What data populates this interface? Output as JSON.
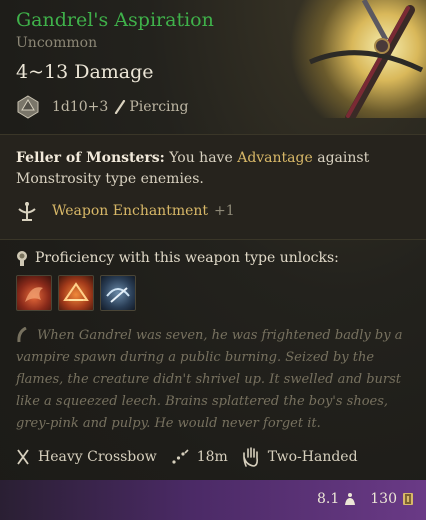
{
  "item": {
    "name": "Gandrel's Aspiration",
    "rarity": "Uncommon",
    "damage": "4~13 Damage",
    "dice": "1d10+3",
    "damage_type": "Piercing"
  },
  "passive": {
    "name": "Feller of Monsters:",
    "text_1": " You have ",
    "advantage": "Advantage",
    "text_2": " against Monstrosity type enemies."
  },
  "enchantment": {
    "label": "Weapon Enchantment",
    "bonus": "+1"
  },
  "proficiency": {
    "heading": "Proficiency with this weapon type unlocks:",
    "skill_icons": [
      "skill-flame-creature-icon",
      "skill-burning-burst-icon",
      "skill-arrow-trap-icon"
    ]
  },
  "lore": "When Gandrel was seven, he was frightened badly by a vampire spawn during a public burning. Seized by the flames, the creature didn't shrivel up. It swelled and burst like a squeezed leech. Brains splattered the boy's shoes, grey-pink and pulpy. He would never forget it.",
  "properties": {
    "weapon_type": "Heavy Crossbow",
    "range": "18m",
    "handedness": "Two-Handed"
  },
  "footer": {
    "weight": "8.1",
    "value": "130"
  },
  "colors": {
    "rarity_green": "#3fb14a",
    "accent_gold": "#d8b868",
    "footer_purple": "#6a3a86"
  }
}
